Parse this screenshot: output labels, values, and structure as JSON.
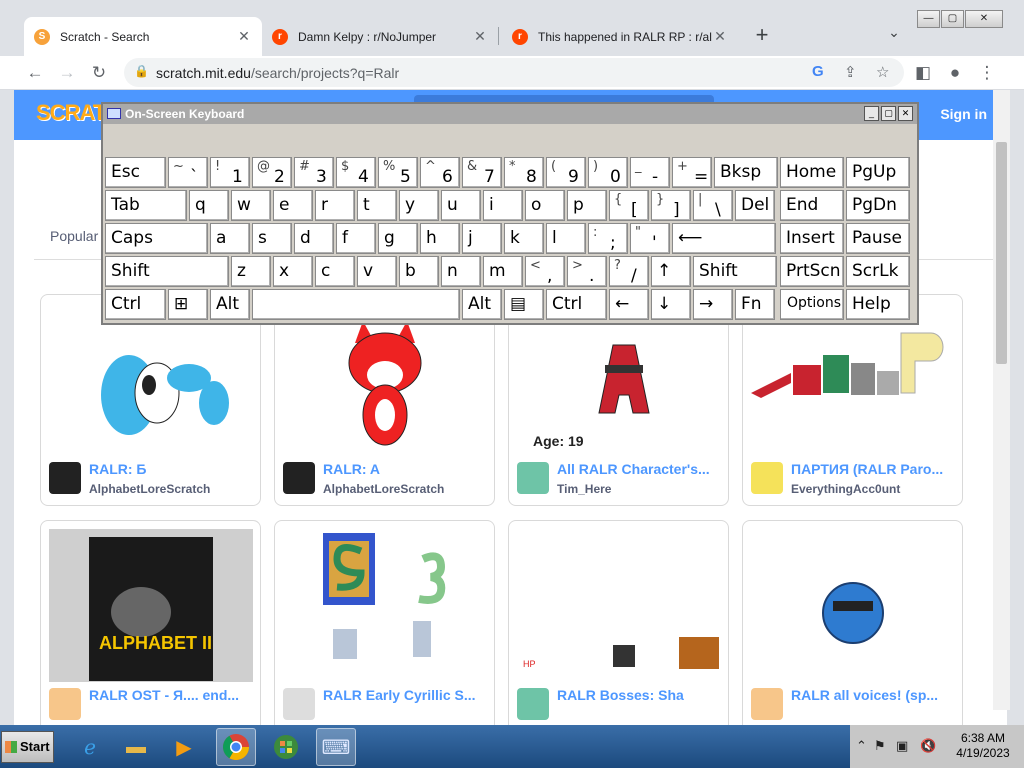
{
  "browser": {
    "tabs": [
      {
        "title": "Scratch - Search",
        "favicon": "scratch-icon",
        "active": true
      },
      {
        "title": "Damn Kelpy : r/NoJumper",
        "favicon": "reddit-icon",
        "active": false
      },
      {
        "title": "This happened in RALR RP : r/alpha",
        "favicon": "reddit-icon",
        "active": false
      }
    ],
    "new_tab": "+",
    "tab_list": "⌄",
    "url_host": "scratch.mit.edu",
    "url_path": "/search/projects?q=Ralr",
    "window_controls": {
      "minimize": "—",
      "maximize": "▢",
      "close": "✕"
    }
  },
  "scratch": {
    "logo": "SCRATCH",
    "signin": "Sign in",
    "filter_label": "Popular",
    "projects": [
      {
        "title": "RALR: Б",
        "author": "AlphabetLoreScratch",
        "thumb_note": ""
      },
      {
        "title": "RALR: A",
        "author": "AlphabetLoreScratch",
        "thumb_note": ""
      },
      {
        "title": "All RALR Character's...",
        "author": "Tim_Here",
        "thumb_note": "Age: 19"
      },
      {
        "title": "ПАРТИЯ (RALR Paro...",
        "author": "EverythingAcc0unt",
        "thumb_note": ""
      },
      {
        "title": "RALR OST - Я.... end...",
        "author": "",
        "thumb_note": "ALPHABET II"
      },
      {
        "title": "RALR Early Cyrillic S...",
        "author": "",
        "thumb_note": ""
      },
      {
        "title": "RALR Bosses: Sha",
        "author": "",
        "thumb_note": ""
      },
      {
        "title": "RALR all voices! (sp...",
        "author": "",
        "thumb_note": ""
      }
    ]
  },
  "osk": {
    "title": "On-Screen Keyboard",
    "rows": [
      [
        {
          "l": "Esc"
        },
        {
          "s": "~",
          "b": "`"
        },
        {
          "s": "!",
          "b": "1"
        },
        {
          "s": "@",
          "b": "2"
        },
        {
          "s": "#",
          "b": "3"
        },
        {
          "s": "$",
          "b": "4"
        },
        {
          "s": "%",
          "b": "5"
        },
        {
          "s": "^",
          "b": "6"
        },
        {
          "s": "&",
          "b": "7"
        },
        {
          "s": "*",
          "b": "8"
        },
        {
          "s": "(",
          "b": "9"
        },
        {
          "s": ")",
          "b": "0"
        },
        {
          "s": "_",
          "b": "-"
        },
        {
          "s": "+",
          "b": "="
        },
        {
          "l": "Bksp"
        },
        {
          "l": "Home"
        },
        {
          "l": "PgUp"
        }
      ],
      [
        {
          "l": "Tab"
        },
        {
          "l": "q"
        },
        {
          "l": "w"
        },
        {
          "l": "e"
        },
        {
          "l": "r"
        },
        {
          "l": "t"
        },
        {
          "l": "y"
        },
        {
          "l": "u"
        },
        {
          "l": "i"
        },
        {
          "l": "o"
        },
        {
          "l": "p"
        },
        {
          "s": "{",
          "b": "["
        },
        {
          "s": "}",
          "b": "]"
        },
        {
          "s": "|",
          "b": "\\"
        },
        {
          "l": "Del"
        },
        {
          "l": "End"
        },
        {
          "l": "PgDn"
        }
      ],
      [
        {
          "l": "Caps"
        },
        {
          "l": "a"
        },
        {
          "l": "s"
        },
        {
          "l": "d"
        },
        {
          "l": "f"
        },
        {
          "l": "g"
        },
        {
          "l": "h"
        },
        {
          "l": "j"
        },
        {
          "l": "k"
        },
        {
          "l": "l"
        },
        {
          "s": ":",
          "b": ";"
        },
        {
          "s": "\"",
          "b": "'"
        },
        {
          "l": "⟵"
        },
        {
          "l": "Insert"
        },
        {
          "l": "Pause"
        }
      ],
      [
        {
          "l": "Shift"
        },
        {
          "l": "z"
        },
        {
          "l": "x"
        },
        {
          "l": "c"
        },
        {
          "l": "v"
        },
        {
          "l": "b"
        },
        {
          "l": "n"
        },
        {
          "l": "m"
        },
        {
          "s": "<",
          "b": ","
        },
        {
          "s": ">",
          "b": "."
        },
        {
          "s": "?",
          "b": "/"
        },
        {
          "l": "↑"
        },
        {
          "l": "Shift"
        },
        {
          "l": "PrtScn"
        },
        {
          "l": "ScrLk"
        }
      ],
      [
        {
          "l": "Ctrl"
        },
        {
          "l": "⊞"
        },
        {
          "l": "Alt"
        },
        {
          "l": ""
        },
        {
          "l": "Alt"
        },
        {
          "l": "▤"
        },
        {
          "l": "Ctrl"
        },
        {
          "l": "←"
        },
        {
          "l": "↓"
        },
        {
          "l": "→"
        },
        {
          "l": "Fn"
        },
        {
          "l": "Options"
        },
        {
          "l": "Help"
        }
      ]
    ]
  },
  "taskbar": {
    "start": "Start",
    "clock_time": "6:38 AM",
    "clock_date": "4/19/2023"
  }
}
